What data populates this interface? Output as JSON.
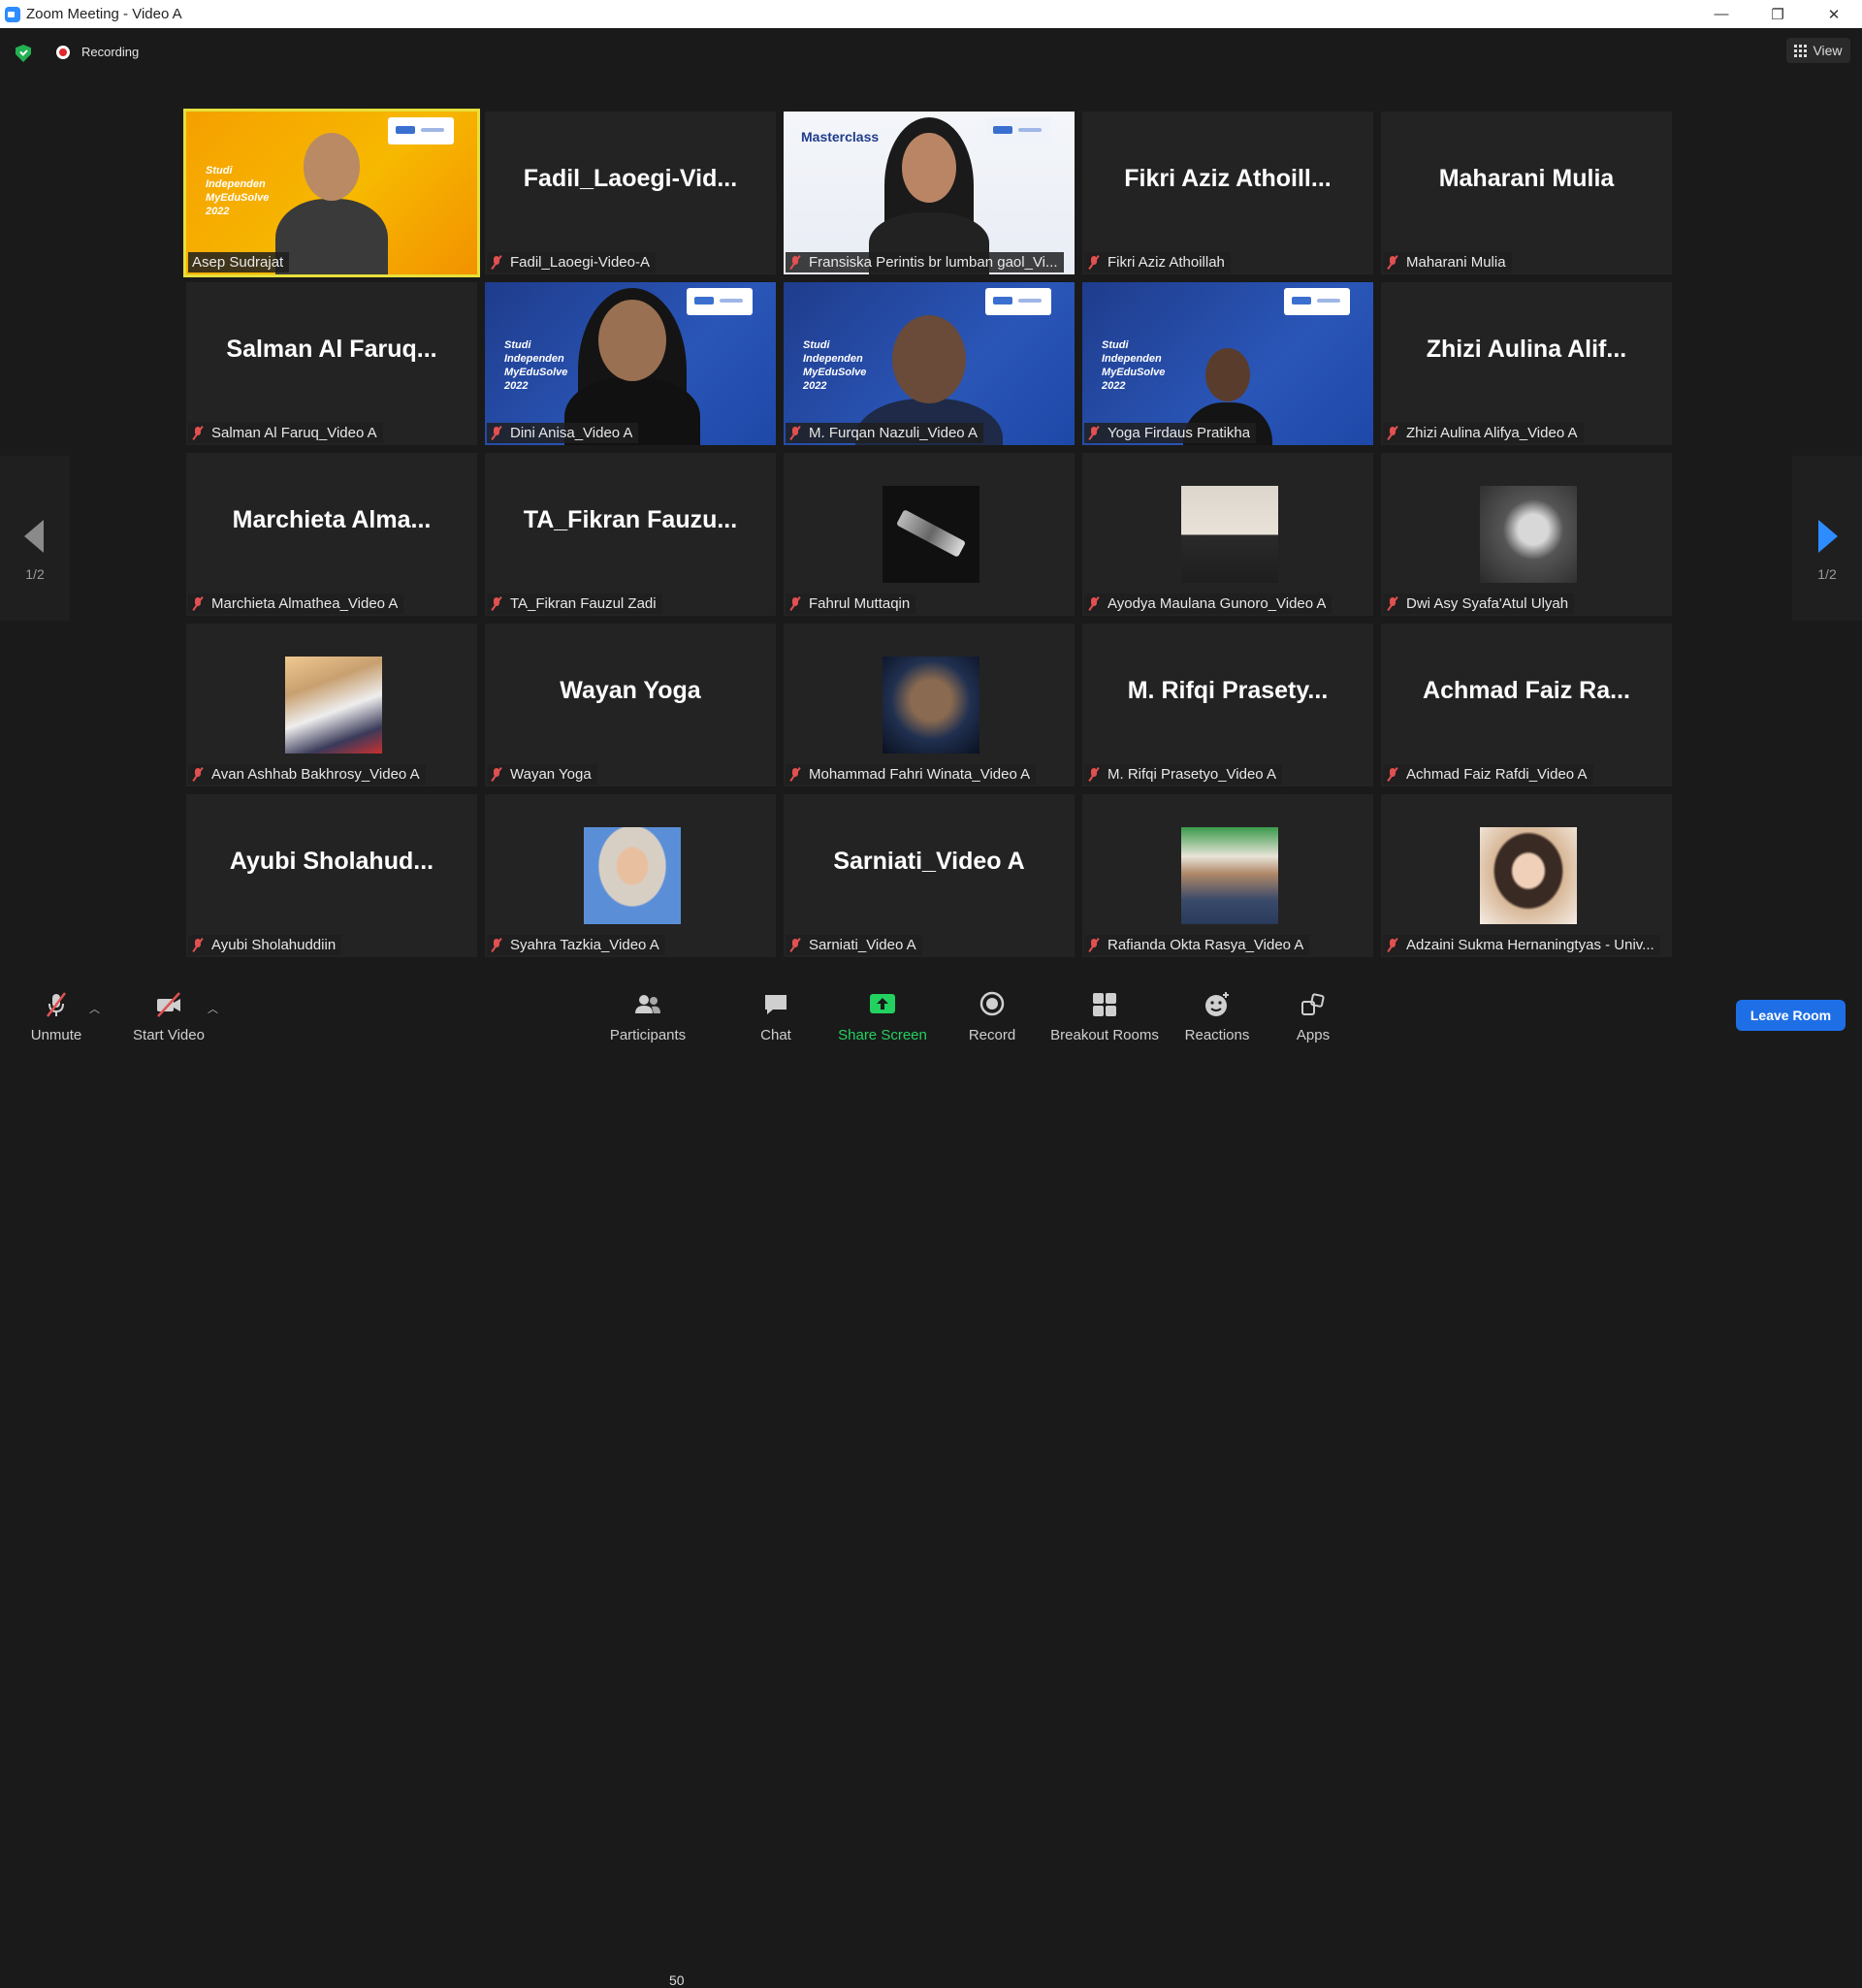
{
  "window": {
    "title": "Zoom Meeting - Video A",
    "controls": [
      "—",
      "❐",
      "✕"
    ]
  },
  "topbar": {
    "recording_label": "Recording",
    "view_label": "View"
  },
  "gallery": {
    "page_indicator_left": "1/2",
    "page_indicator_right": "1/2",
    "tiles": [
      {
        "label": "Asep Sudrajat",
        "big": "",
        "feed": "orange-speaker",
        "speaking": true,
        "muted": false
      },
      {
        "label": "Fadil_Laoegi-Video-A",
        "big": "Fadil_Laoegi-Vid...",
        "feed": "none",
        "muted": true
      },
      {
        "label": "Fransiska Perintis br lumban gaol_Vi...",
        "big": "",
        "feed": "masterclass",
        "muted": true
      },
      {
        "label": "Fikri Aziz Athoillah",
        "big": "Fikri Aziz Athoill...",
        "feed": "none",
        "muted": true
      },
      {
        "label": "Maharani Mulia",
        "big": "Maharani Mulia",
        "feed": "none",
        "muted": true
      },
      {
        "label": "Salman Al Faruq_Video A",
        "big": "Salman Al Faruq...",
        "feed": "none",
        "muted": true
      },
      {
        "label": "Dini Anisa_Video A",
        "big": "",
        "feed": "blue-hijab",
        "muted": true
      },
      {
        "label": "M. Furqan Nazuli_Video A",
        "big": "",
        "feed": "blue-boy",
        "muted": true
      },
      {
        "label": "Yoga Firdaus Pratikha",
        "big": "",
        "feed": "blue-headset",
        "muted": true
      },
      {
        "label": "Zhizi Aulina Alifya_Video A",
        "big": "Zhizi Aulina Alif...",
        "feed": "none",
        "muted": true
      },
      {
        "label": "Marchieta Almathea_Video A",
        "big": "Marchieta Alma...",
        "feed": "none",
        "muted": true
      },
      {
        "label": "TA_Fikran Fauzul Zadi",
        "big": "TA_Fikran Fauzu...",
        "feed": "none",
        "muted": true
      },
      {
        "label": "Fahrul Muttaqin",
        "big": "",
        "feed": "thumb-robot",
        "muted": true
      },
      {
        "label": "Ayodya Maulana Gunoro_Video A",
        "big": "",
        "feed": "thumb-man",
        "muted": true
      },
      {
        "label": "Dwi Asy Syafa'Atul Ulyah",
        "big": "",
        "feed": "thumb-bw",
        "muted": true
      },
      {
        "label": "Avan Ashhab Bakhrosy_Video A",
        "big": "",
        "feed": "thumb-gundam",
        "muted": true
      },
      {
        "label": "Wayan Yoga",
        "big": "Wayan Yoga",
        "feed": "none",
        "muted": true
      },
      {
        "label": "Mohammad Fahri Winata_Video A",
        "big": "",
        "feed": "thumb-groot",
        "muted": true
      },
      {
        "label": "M. Rifqi Prasetyo_Video A",
        "big": "M. Rifqi Prasety...",
        "feed": "none",
        "muted": true
      },
      {
        "label": "Achmad Faiz Rafdi_Video A",
        "big": "Achmad Faiz Ra...",
        "feed": "none",
        "muted": true
      },
      {
        "label": "Ayubi Sholahuddiin",
        "big": "Ayubi Sholahud...",
        "feed": "none",
        "muted": true
      },
      {
        "label": "Syahra Tazkia_Video A",
        "big": "",
        "feed": "thumb-hijab",
        "muted": true
      },
      {
        "label": "Sarniati_Video A",
        "big": "Sarniati_Video A",
        "feed": "none",
        "muted": true
      },
      {
        "label": "Rafianda Okta Rasya_Video A",
        "big": "",
        "feed": "thumb-green",
        "muted": true
      },
      {
        "label": "Adzaini Sukma Hernaningtyas - Univ...",
        "big": "",
        "feed": "thumb-anime",
        "muted": true
      }
    ],
    "studi_text": [
      "Studi",
      "Independen",
      "MyEduSolve",
      "2022"
    ],
    "masterclass_text": "Masterclass"
  },
  "toolbar": {
    "unmute": "Unmute",
    "start_video": "Start Video",
    "participants": "Participants",
    "participants_count": "50",
    "chat": "Chat",
    "share_screen": "Share Screen",
    "record": "Record",
    "breakout_rooms": "Breakout Rooms",
    "reactions": "Reactions",
    "apps": "Apps",
    "leave": "Leave Room"
  },
  "colors": {
    "accent": "#2d8cff",
    "share": "#23d160",
    "speaker_border": "#e8df3a",
    "leave": "#1e6fe6",
    "muted": "#e25050"
  }
}
